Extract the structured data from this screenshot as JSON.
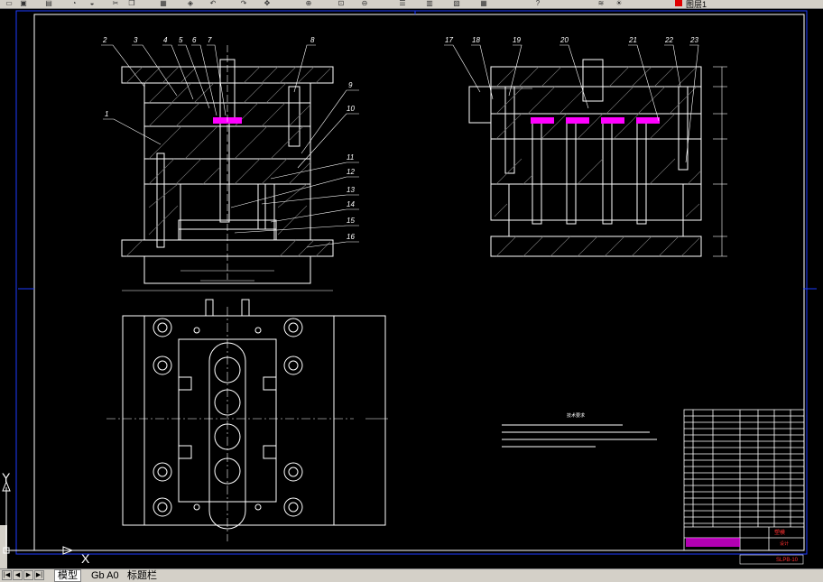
{
  "toolbar": {
    "icons": [
      "open-icon",
      "save-icon",
      "print-icon",
      "preview-icon",
      "publish-icon",
      "cut-icon",
      "copy-icon",
      "paste-icon",
      "match-icon",
      "undo-icon",
      "redo-icon",
      "pan-icon",
      "zoom-realtime-icon",
      "zoom-window-icon",
      "zoom-previous-icon",
      "properties-icon",
      "designcenter-icon",
      "toolpalette-icon",
      "calculator-icon",
      "help-icon",
      "layer-manager-icon",
      "layer-state-icon"
    ],
    "layer_name": "图层1",
    "layer_color": "#e00000"
  },
  "drawing": {
    "callouts_front": [
      "2",
      "3",
      "4",
      "5",
      "6",
      "7",
      "8",
      "1",
      "9",
      "10",
      "11",
      "12",
      "13",
      "14",
      "15",
      "16"
    ],
    "callouts_side": [
      "17",
      "18",
      "19",
      "20",
      "21",
      "22",
      "23"
    ],
    "notes_title": "技术要求",
    "title_block_code": "SLPB-10",
    "title_block_red": "塑模",
    "title_block_sub": "设计"
  },
  "ucs": {
    "x_label": "X",
    "y_label": "Y"
  },
  "tabs": {
    "nav": [
      "first",
      "prev",
      "next",
      "last"
    ],
    "items": [
      "模型",
      "Gb A0",
      "标题栏"
    ]
  }
}
